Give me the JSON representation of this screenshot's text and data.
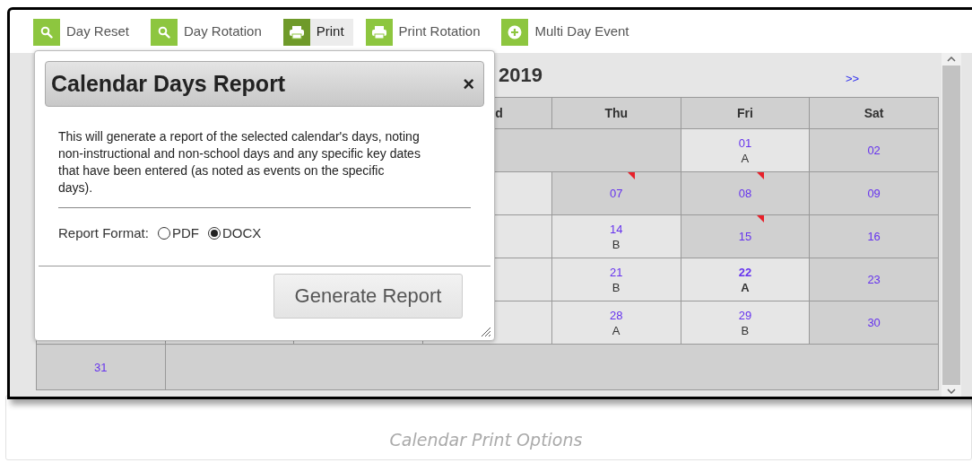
{
  "toolbar": [
    {
      "label": "Day Reset",
      "kind": "search",
      "selected": false
    },
    {
      "label": "Day Rotation",
      "kind": "search",
      "selected": false
    },
    {
      "label": "Print",
      "kind": "print",
      "selected": true
    },
    {
      "label": "Print Rotation",
      "kind": "print",
      "selected": false
    },
    {
      "label": "Multi Day Event",
      "kind": "add",
      "selected": false
    }
  ],
  "calendar": {
    "title": "2019",
    "next": ">>",
    "columns": [
      {
        "label": "d"
      },
      {
        "label": "Thu"
      },
      {
        "label": "Fri"
      },
      {
        "label": "Sat"
      }
    ],
    "weeks": [
      {
        "cells": [
          {
            "kind": "filler"
          },
          {
            "kind": "filler"
          },
          {
            "kind": "day",
            "day": "01",
            "rotation": "A",
            "school_day": true,
            "event": false,
            "today": false
          },
          {
            "kind": "day",
            "day": "02",
            "school_day": false,
            "event": false,
            "today": false
          }
        ]
      },
      {
        "cells": [
          {
            "kind": "covered",
            "school_day": true
          },
          {
            "kind": "day",
            "day": "07",
            "school_day": false,
            "event": true,
            "today": false
          },
          {
            "kind": "day",
            "day": "08",
            "school_day": false,
            "event": true,
            "today": false
          },
          {
            "kind": "day",
            "day": "09",
            "school_day": false,
            "event": false,
            "today": false
          }
        ]
      },
      {
        "cells": [
          {
            "kind": "covered",
            "school_day": true
          },
          {
            "kind": "day",
            "day": "14",
            "rotation": "B",
            "school_day": true,
            "event": false,
            "today": false
          },
          {
            "kind": "day",
            "day": "15",
            "school_day": false,
            "event": true,
            "today": false
          },
          {
            "kind": "day",
            "day": "16",
            "school_day": false,
            "event": false,
            "today": false
          }
        ]
      },
      {
        "cells": [
          {
            "kind": "covered",
            "school_day": true
          },
          {
            "kind": "day",
            "day": "21",
            "rotation": "B",
            "school_day": true,
            "event": false,
            "today": false
          },
          {
            "kind": "day",
            "day": "22",
            "rotation": "A",
            "school_day": true,
            "event": false,
            "today": true
          },
          {
            "kind": "day",
            "day": "23",
            "school_day": false,
            "event": false,
            "today": false
          }
        ]
      },
      {
        "cells": [
          {
            "kind": "covered",
            "school_day": true
          },
          {
            "kind": "day",
            "day": "28",
            "rotation": "A",
            "school_day": true,
            "event": false,
            "today": false
          },
          {
            "kind": "day",
            "day": "29",
            "rotation": "B",
            "school_day": true,
            "event": false,
            "today": false
          },
          {
            "kind": "day",
            "day": "30",
            "school_day": false,
            "event": false,
            "today": false
          }
        ]
      },
      {
        "cells": [
          {
            "kind": "day",
            "day": "31",
            "school_day": false,
            "event": false,
            "today": false
          },
          {
            "kind": "filler"
          },
          {
            "kind": "filler"
          },
          {
            "kind": "filler"
          },
          {
            "kind": "filler"
          },
          {
            "kind": "filler"
          },
          {
            "kind": "filler"
          }
        ]
      }
    ]
  },
  "dialog": {
    "title": "Calendar Days Report",
    "close": "×",
    "description": "This will generate a report of the selected calendar's days, noting non-instructional and non-school days and any specific key dates that have been entered (as noted as events on the specific days).",
    "format_label": "Report Format:",
    "formats": [
      {
        "label": "PDF",
        "selected": false
      },
      {
        "label": "DOCX",
        "selected": true
      }
    ],
    "button": "Generate Report"
  },
  "caption": "Calendar Print Options"
}
